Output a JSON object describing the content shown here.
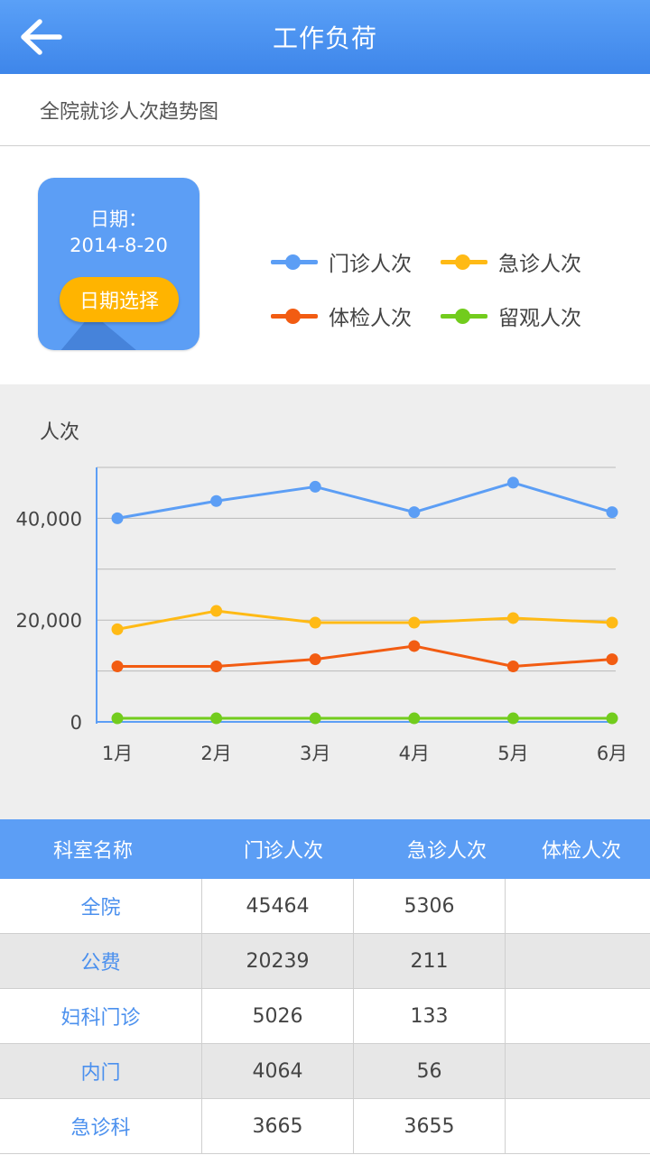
{
  "header": {
    "title": "工作负荷"
  },
  "subtitle": "全院就诊人次趋势图",
  "date_card": {
    "label": "日期：",
    "date": "2014-8-20",
    "button_label": "日期选择"
  },
  "legend": [
    {
      "name": "门诊人次",
      "color": "#5c9ef5"
    },
    {
      "name": "急诊人次",
      "color": "#ffba15"
    },
    {
      "name": "体检人次",
      "color": "#f25c12"
    },
    {
      "name": "留观人次",
      "color": "#72cc1d"
    }
  ],
  "chart_data": {
    "type": "line",
    "ylabel": "人次",
    "categories": [
      "1月",
      "2月",
      "3月",
      "4月",
      "5月",
      "6月"
    ],
    "yticks": [
      {
        "value": 0,
        "label": "0"
      },
      {
        "value": 20000,
        "label": "20,000"
      },
      {
        "value": 40000,
        "label": "40,000"
      }
    ],
    "ylim": [
      0,
      50000
    ],
    "grid": true,
    "series": [
      {
        "name": "门诊人次",
        "color": "#5c9ef5",
        "values": [
          40000,
          43400,
          46200,
          41200,
          47000,
          41200
        ]
      },
      {
        "name": "急诊人次",
        "color": "#ffba15",
        "values": [
          18200,
          21800,
          19500,
          19500,
          20400,
          19500
        ]
      },
      {
        "name": "体检人次",
        "color": "#f25c12",
        "values": [
          10900,
          10900,
          12300,
          14900,
          10900,
          12300
        ]
      },
      {
        "name": "留观人次",
        "color": "#72cc1d",
        "values": [
          700,
          700,
          700,
          700,
          700,
          700
        ]
      }
    ]
  },
  "table": {
    "headers": [
      "科室名称",
      "门诊人次",
      "急诊人次",
      "体检人次"
    ],
    "rows": [
      [
        "全院",
        "45464",
        "5306",
        ""
      ],
      [
        "公费",
        "20239",
        "211",
        ""
      ],
      [
        "妇科门诊",
        "5026",
        "133",
        ""
      ],
      [
        "内门",
        "4064",
        "56",
        ""
      ],
      [
        "急诊科",
        "3665",
        "3655",
        ""
      ]
    ]
  }
}
